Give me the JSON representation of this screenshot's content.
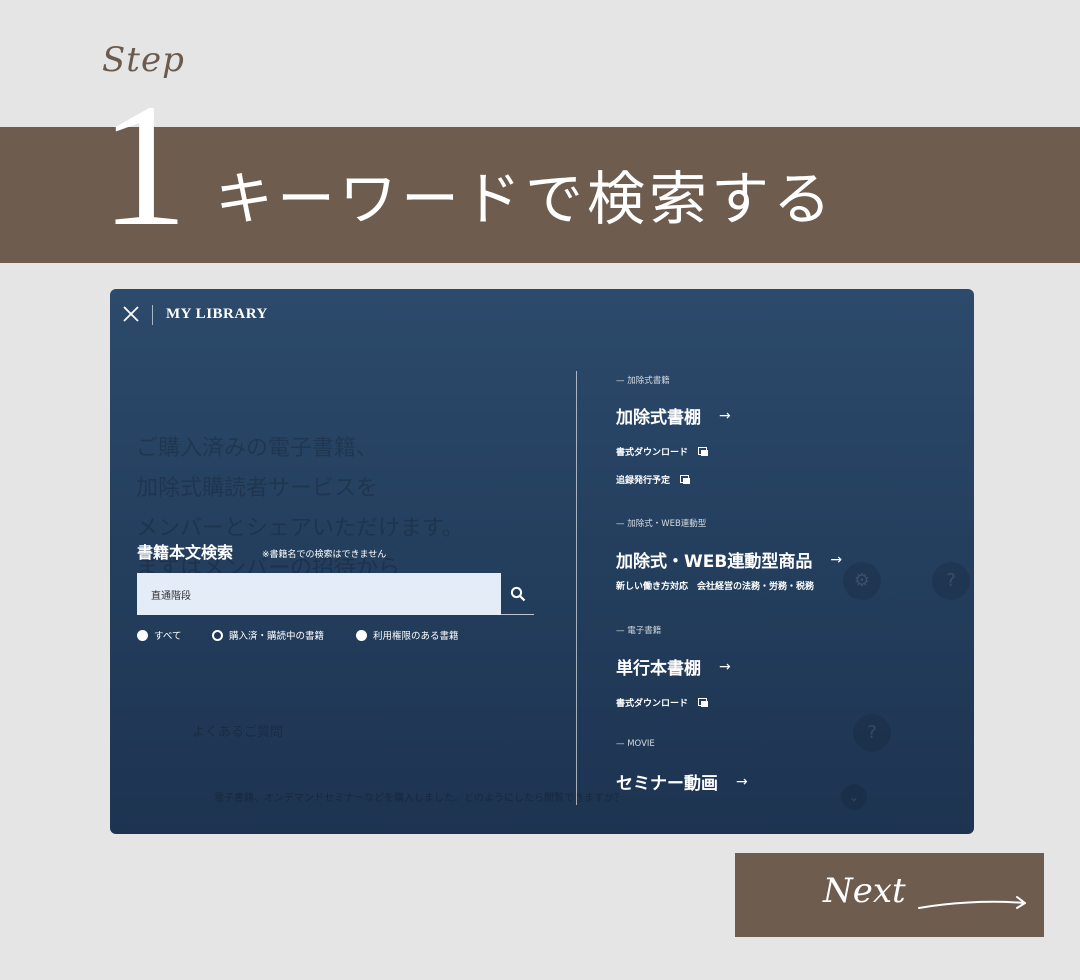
{
  "step": {
    "label": "Step",
    "number": "1",
    "title": "キーワードで検索する"
  },
  "panel": {
    "brand": "MY LIBRARY",
    "search": {
      "title": "書籍本文検索",
      "note": "※書籍名での検索はできません",
      "value": "直通階段",
      "options": [
        "すべて",
        "購入済・購読中の書籍",
        "利用権限のある書籍"
      ],
      "selected": "購入済・購読中の書籍"
    },
    "sections": [
      {
        "label": "— 加除式書籍",
        "title": "加除式書棚",
        "links": [
          "書式ダウンロード",
          "追録発行予定"
        ]
      },
      {
        "label": "— 加除式・WEB連動型",
        "title": "加除式・WEB連動型商品",
        "subtext": "新しい働き方対応　会社経営の法務・労務・税務"
      },
      {
        "label": "— 電子書籍",
        "title": "単行本書棚",
        "links": [
          "書式ダウンロード"
        ]
      },
      {
        "label": "— MOVIE",
        "title": "セミナー動画"
      }
    ],
    "arrow": "→",
    "background": {
      "headline_lines": [
        "ご購入済みの電子書籍、",
        "加除式購読者サービスを",
        "メンバーとシェアいただけます。",
        "まずはメンバーの招待から"
      ],
      "faq_title": "よくあるご質問",
      "faq_question": "電子書籍、オンデマンドセミナーなどを購入しました。どのようにしたら閲覧できますか？"
    }
  },
  "next": {
    "label": "Next"
  },
  "colors": {
    "brown": "#6e5c4e",
    "navy": "#233d5c",
    "background": "#e5e5e5"
  }
}
